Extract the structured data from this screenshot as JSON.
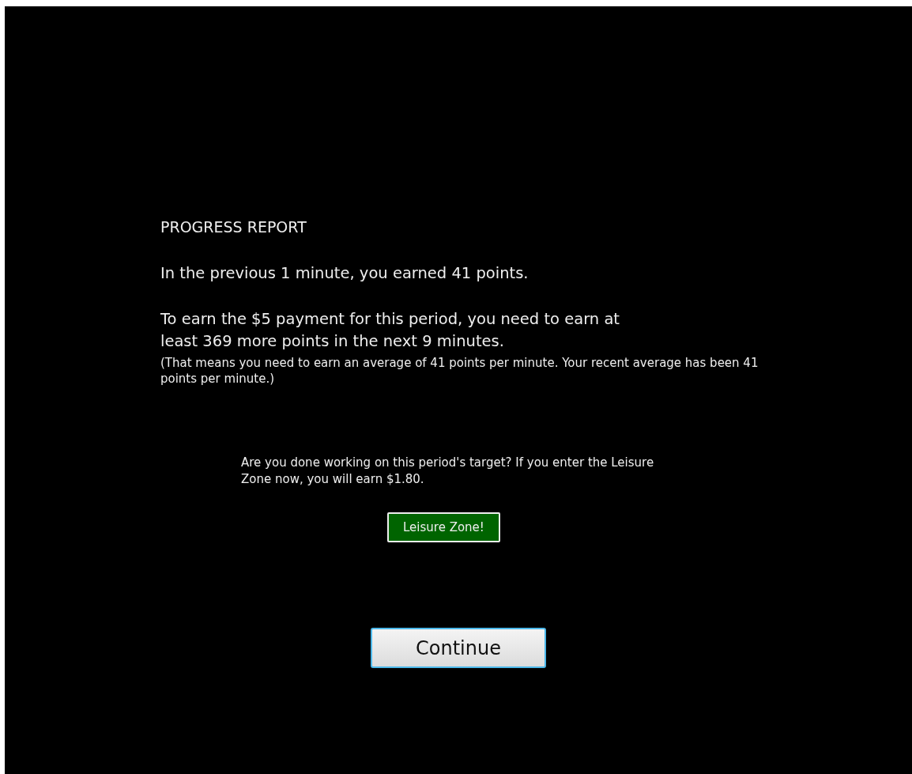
{
  "report": {
    "heading": "PROGRESS REPORT",
    "paragraphs": [
      "In the previous 1 minute, you earned 41 points.",
      "To earn the $5 payment for this period, you need to earn at least 369 more points in the next 9 minutes."
    ],
    "note": "(That means you need to earn an average of 41 points per minute. Your recent average has been 41 points per minute.)"
  },
  "question": "Are you done working on this period's target? If you enter the Leisure Zone now, you will earn $1.80.",
  "buttons": [
    {
      "kind": "leisure",
      "label": "Leisure Zone!"
    },
    {
      "kind": "continue",
      "label": "Continue"
    }
  ]
}
